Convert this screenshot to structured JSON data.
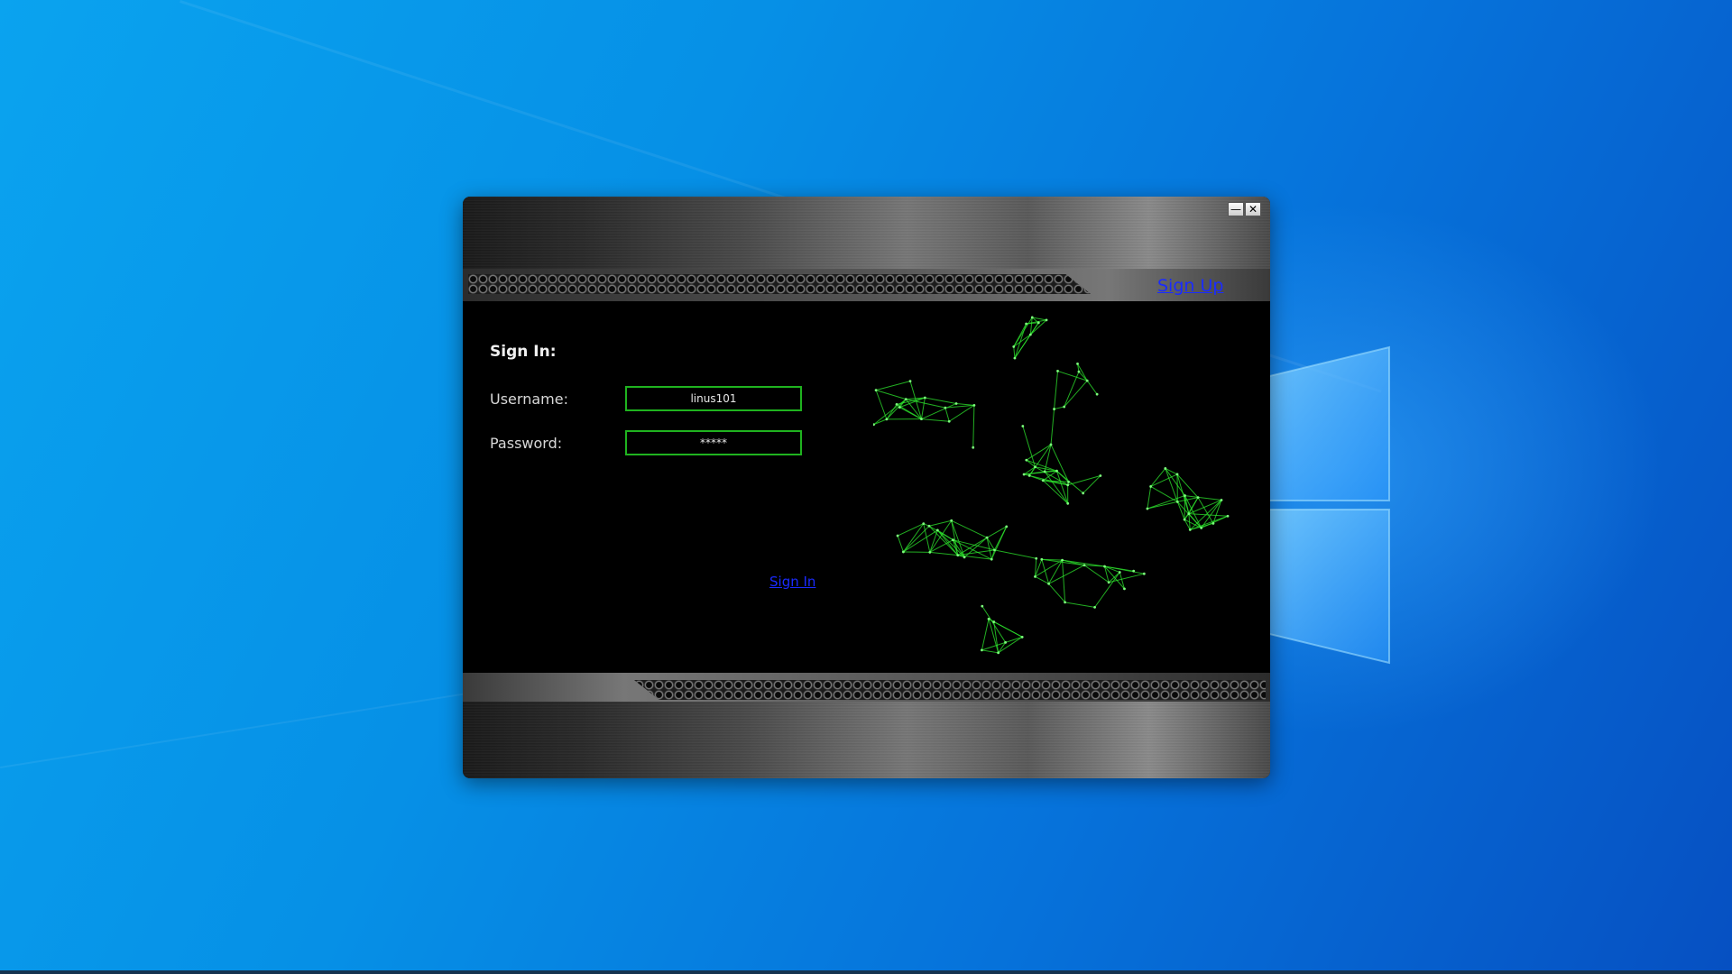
{
  "window": {
    "minimize_symbol": "—",
    "close_symbol": "✕",
    "signup_label": "Sign Up"
  },
  "form": {
    "heading": "Sign In:",
    "username_label": "Username:",
    "username_value": "linus101",
    "password_label": "Password:",
    "password_value": "*****",
    "signin_label": "Sign In"
  },
  "colors": {
    "accent_green": "#1fb31f",
    "link_blue": "#1a2bff",
    "desktop_blue": "#0690e6"
  },
  "icons": {
    "minimize": "minimize-icon",
    "close": "close-icon",
    "windows_logo": "windows-logo"
  }
}
